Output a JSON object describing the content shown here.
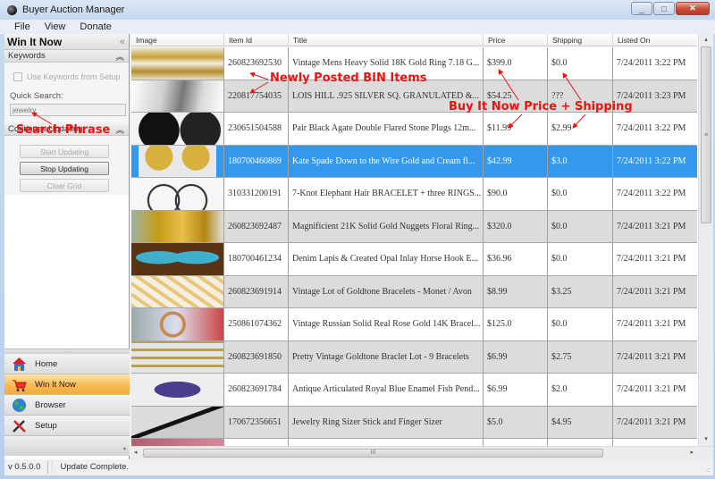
{
  "window": {
    "title": "Buyer Auction Manager",
    "minimize_label": "_",
    "maximize_label": "□",
    "close_label": "✕"
  },
  "menu": [
    {
      "label": "File"
    },
    {
      "label": "View"
    },
    {
      "label": "Donate"
    }
  ],
  "left_panel": {
    "title": "Win It Now",
    "collapse_glyph": "«",
    "keywords_section": {
      "title": "Keywords",
      "collapse_glyph": "︽",
      "use_keywords_label": "Use Keywords from Setup",
      "use_keywords_checked": false,
      "quick_search_label": "Quick Search:",
      "quick_search_value": "jewelry"
    },
    "updating_section": {
      "title": "Continues Updating",
      "collapse_glyph": "︽",
      "buttons": [
        {
          "label": "Start Updating",
          "enabled": false
        },
        {
          "label": "Stop Updating",
          "enabled": true
        },
        {
          "label": "Clear Grid",
          "enabled": false
        }
      ]
    },
    "splitter_glyph": "::::",
    "nav": [
      {
        "label": "Home",
        "icon": "home-icon",
        "selected": false
      },
      {
        "label": "Win It Now",
        "icon": "shopping-cart-icon",
        "selected": true
      },
      {
        "label": "Browser",
        "icon": "globe-icon",
        "selected": false
      },
      {
        "label": "Setup",
        "icon": "tools-icon",
        "selected": false
      }
    ],
    "nav_footer_glyph": "▾"
  },
  "grid": {
    "columns": [
      "Image",
      "Item Id",
      "Title",
      "Price",
      "Shipping",
      "Listed On"
    ],
    "selected_row_index": 3,
    "rows": [
      {
        "image": "gold-ring",
        "item_id": "260823692530",
        "title": "Vintage Mens Heavy Solid 18K Gold Ring 7.18 G...",
        "price": "$399.0",
        "shipping": "$0.0",
        "listed_on": "7/24/2011 3:22 PM"
      },
      {
        "image": "silver-ring",
        "item_id": "220817754035",
        "title": "LOIS HILL .925 SILVER SQ. GRANULATED &...",
        "price": "$54.25",
        "shipping": "???",
        "listed_on": "7/24/2011 3:23 PM"
      },
      {
        "image": "black-plugs",
        "item_id": "230651504588",
        "title": "Pair Black Agate Double Flared Stone Plugs 12m...",
        "price": "$11.99",
        "shipping": "$2.99",
        "listed_on": "7/24/2011 3:22 PM"
      },
      {
        "image": "gold-earrings",
        "item_id": "180700460869",
        "title": "Kate Spade Down to the Wire Gold and Cream fl...",
        "price": "$42.99",
        "shipping": "$3.0",
        "listed_on": "7/24/2011 3:22 PM"
      },
      {
        "image": "hair-bracelet",
        "item_id": "310331200191",
        "title": "7-Knot Elephant Hair BRACELET + three RINGS...",
        "price": "$90.0",
        "shipping": "$0.0",
        "listed_on": "7/24/2011 3:22 PM"
      },
      {
        "image": "gold-nugget-ring",
        "item_id": "260823692487",
        "title": "Magnificient 21K Solid Gold Nuggets Floral Ring...",
        "price": "$320.0",
        "shipping": "$0.0",
        "listed_on": "7/24/2011 3:21 PM"
      },
      {
        "image": "horse-earrings",
        "item_id": "180700461234",
        "title": "Denim Lapis & Created Opal Inlay Horse Hook E...",
        "price": "$36.96",
        "shipping": "$0.0",
        "listed_on": "7/24/2011 3:21 PM"
      },
      {
        "image": "goldtone-bracelets",
        "item_id": "260823691914",
        "title": "Vintage Lot of Goldtone Bracelets - Monet / Avon",
        "price": "$8.99",
        "shipping": "$3.25",
        "listed_on": "7/24/2011 3:21 PM"
      },
      {
        "image": "rose-gold-bracelet",
        "item_id": "250861074362",
        "title": "Vintage Russian Solid Real Rose Gold 14K Bracel...",
        "price": "$125.0",
        "shipping": "$0.0",
        "listed_on": "7/24/2011 3:21 PM"
      },
      {
        "image": "bracelet-lot",
        "item_id": "260823691850",
        "title": "Pretty Vintage Goldtone Braclet Lot - 9 Bracelets",
        "price": "$6.99",
        "shipping": "$2.75",
        "listed_on": "7/24/2011 3:21 PM"
      },
      {
        "image": "fish-pendant",
        "item_id": "260823691784",
        "title": "Antique Articulated Royal Blue Enamel Fish Pend...",
        "price": "$6.99",
        "shipping": "$2.0",
        "listed_on": "7/24/2011 3:21 PM"
      },
      {
        "image": "ring-sizer",
        "item_id": "170672356651",
        "title": "Jewelry Ring Sizer Stick and Finger Sizer",
        "price": "$5.0",
        "shipping": "$4.95",
        "listed_on": "7/24/2011 3:21 PM"
      },
      {
        "image": "partial",
        "item_id": "",
        "title": "",
        "price": "",
        "shipping": "",
        "listed_on": ""
      }
    ],
    "scroll_up_glyph": "▴",
    "scroll_down_glyph": "▾",
    "scroll_left_glyph": "◂",
    "scroll_right_glyph": "▸",
    "scroll_grip_glyph": "≡",
    "hscroll_grip_glyph": "III"
  },
  "annotations": {
    "search_phrase": "Search Phrase",
    "newly_posted": "Newly Posted BIN Items",
    "bin_price_shipping": "Buy It Now Price + Shipping",
    "color": "#ee1111"
  },
  "status": {
    "version": "v 0.5.0.0",
    "message": "Update Complete.",
    "grip_glyph": ".::"
  },
  "colors": {
    "selected_row": "#3399ee",
    "nav_selected": "#f8b954",
    "alt_row": "#dcdcdc"
  }
}
